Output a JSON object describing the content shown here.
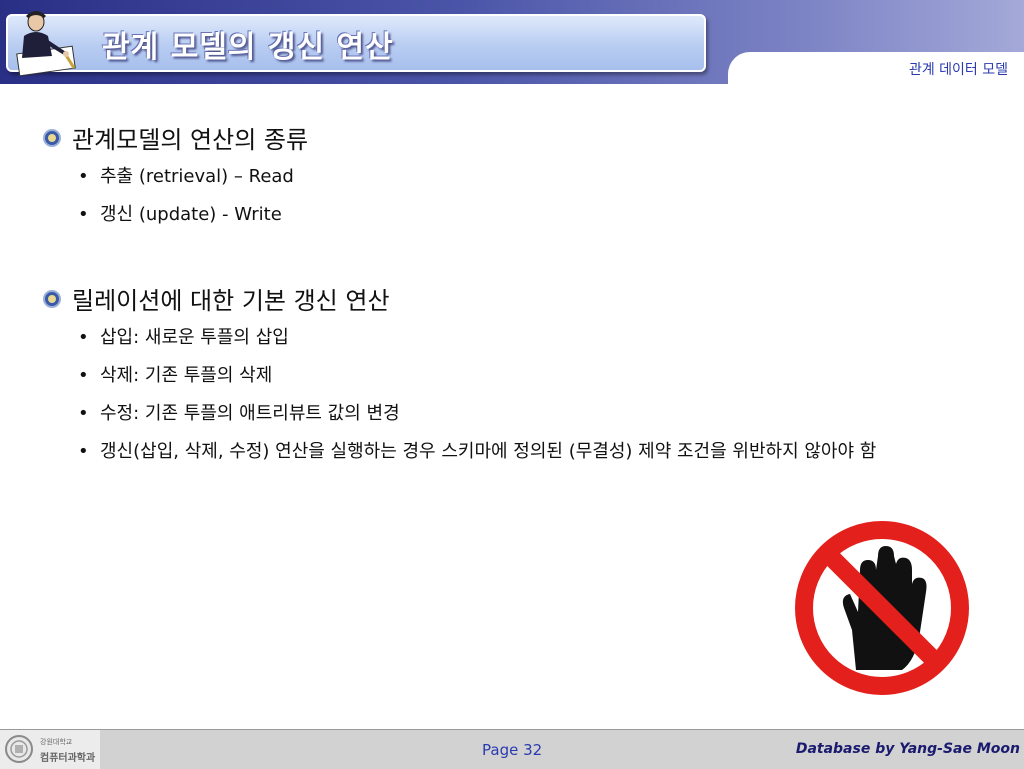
{
  "header": {
    "title": "관계 모델의 갱신 연산",
    "section_label": "관계 데이터 모델"
  },
  "bullets": [
    {
      "label": "관계모델의 연산의 종류",
      "items": [
        "추출 (retrieval) – Read",
        "갱신 (update) - Write"
      ]
    },
    {
      "label": "릴레이션에 대한 기본 갱신 연산",
      "items": [
        "삽입: 새로운 투플의 삽입",
        "삭제: 기존 투플의 삭제",
        "수정: 기존 투플의 애트리뷰트 값의 변경",
        "갱신(삽입, 삭제, 수정) 연산을 실행하는 경우 스키마에 정의된 (무결성) 제약 조건을 위반하지 않아야 함"
      ]
    }
  ],
  "footer": {
    "univ_name": "강원대학교",
    "dept_name": "컴퓨터과학과",
    "page": "Page 32",
    "credit": "Database by Yang-Sae Moon"
  },
  "colors": {
    "header_dark": "#2a2f86",
    "accent_blue": "#2a3bb0",
    "stop_red": "#e3201c"
  },
  "icons": {
    "header": "businessman-writing-icon",
    "bullet": "emblem-bullet-icon",
    "illustration": "stop-hand-icon"
  }
}
